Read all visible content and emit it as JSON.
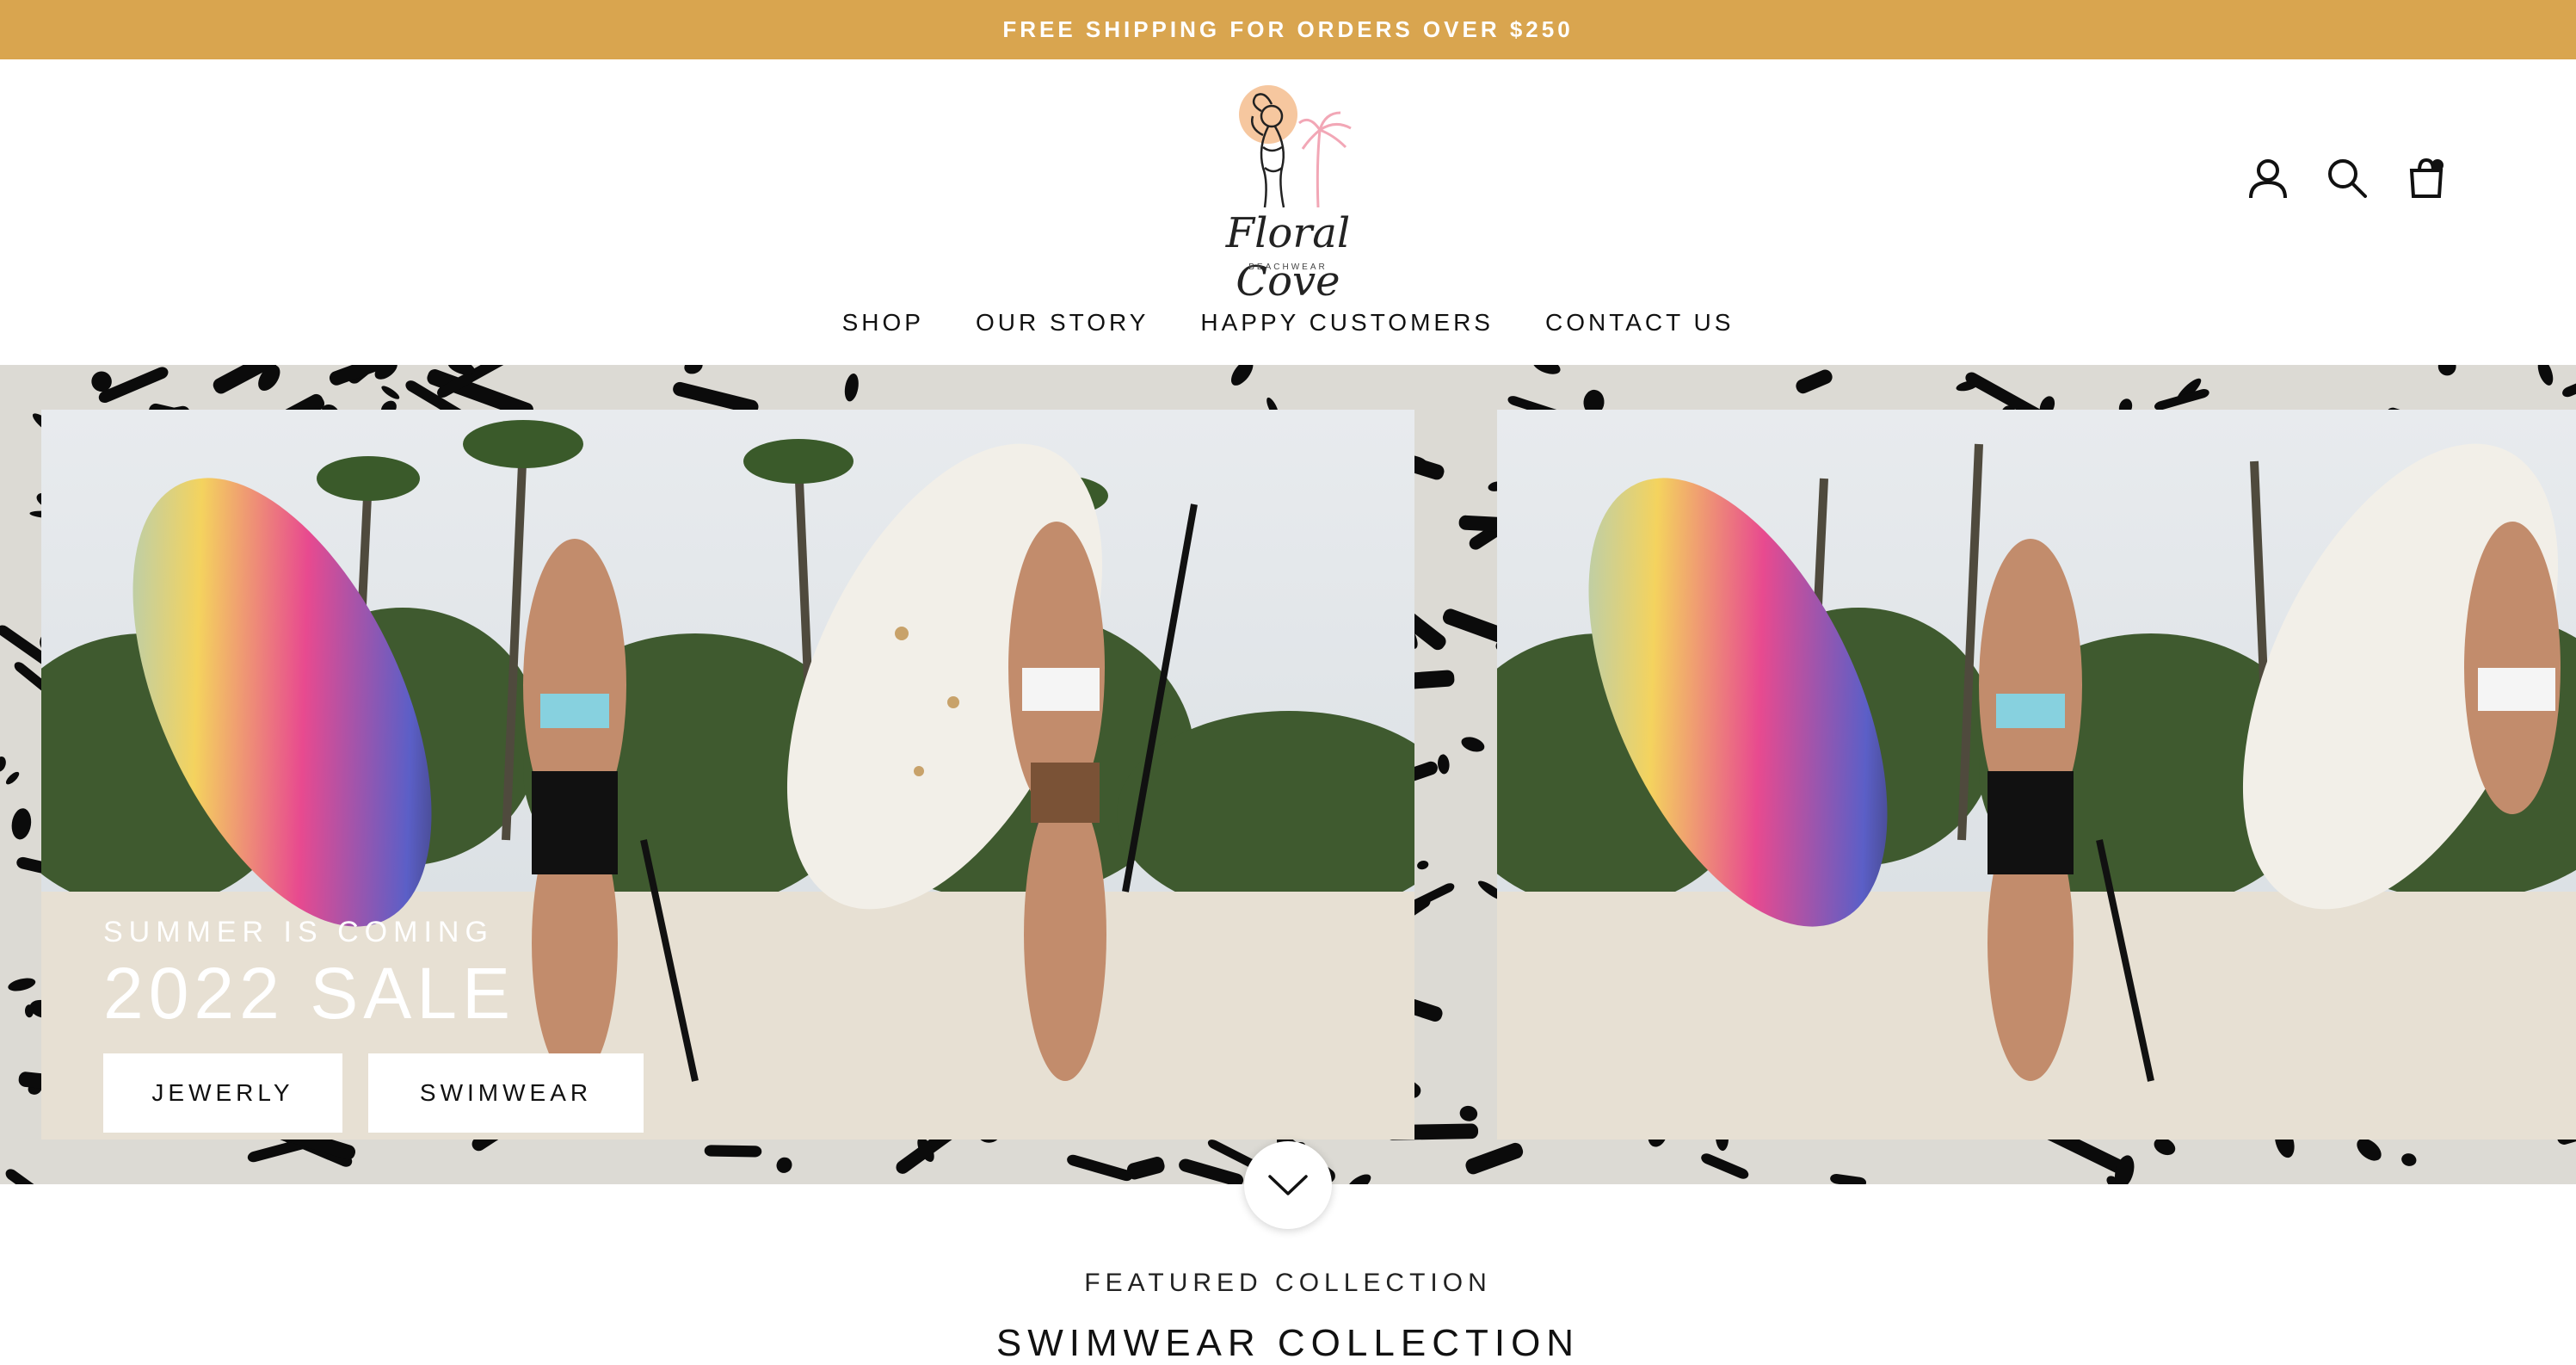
{
  "announcement": {
    "text": "FREE SHIPPING FOR ORDERS OVER $250",
    "bg_color": "#D9A54F",
    "text_color": "#FFFFFF"
  },
  "brand": {
    "name": "Floral Cove",
    "tagline": "BEACHWEAR"
  },
  "header_icons": [
    "account-icon",
    "search-icon",
    "cart-icon"
  ],
  "nav": {
    "items": [
      "SHOP",
      "OUR STORY",
      "HAPPY CUSTOMERS",
      "CONTACT US"
    ]
  },
  "hero": {
    "kicker": "SUMMER IS COMING",
    "title": "2022 SALE",
    "buttons": [
      "JEWERLY",
      "SWIMWEAR"
    ],
    "pattern": "zebra-leopard print frame"
  },
  "featured": {
    "kicker": "FEATURED COLLECTION",
    "title": "SWIMWEAR COLLECTION"
  },
  "colors": {
    "accent": "#D9A54F",
    "sun": "#F6C79F",
    "palm": "#F2A7B6"
  }
}
